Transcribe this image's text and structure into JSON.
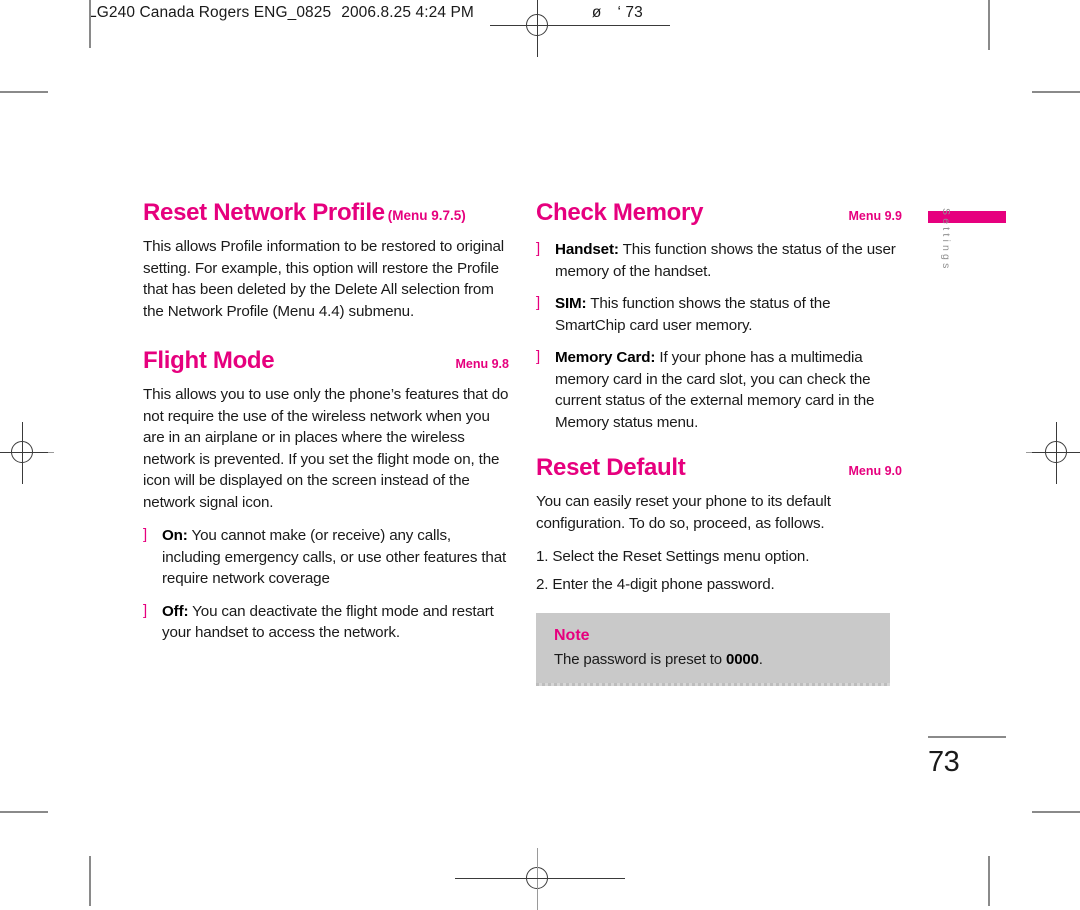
{
  "print_header": {
    "job": "LG240 Canada Rogers ENG_0825",
    "timestamp": "2006.8.25 4:24 PM",
    "ghost_mark": "ø",
    "page_mark": "‘ 73"
  },
  "side_tab": {
    "label": "Settings"
  },
  "page_footer": {
    "page_number": "73"
  },
  "left_column": {
    "sections": [
      {
        "title": "Reset Network Profile",
        "menu_inline": "(Menu 9.7.5)",
        "body": "This allows Profile information to be restored to original setting. For example, this option will restore the Profile that has been deleted by the Delete All selection from the Network Profile (Menu 4.4) submenu."
      },
      {
        "title": "Flight Mode",
        "menu_right": "Menu 9.8",
        "body": "This allows you to use only the phone’s features that do not require the use of the wireless network when you are in an airplane or in places where the wireless network is prevented. If you set the flight mode on, the icon will be displayed on the screen instead of the network signal icon.",
        "bullets": [
          {
            "marker": "]",
            "term": "On:",
            "text": " You cannot make (or receive) any calls, including emergency calls, or use other features that require network coverage"
          },
          {
            "marker": "]",
            "term": "Off:",
            "text": " You can deactivate the flight mode and restart your handset to access the network."
          }
        ]
      }
    ]
  },
  "right_column": {
    "sections": [
      {
        "title": "Check Memory",
        "menu_right": "Menu 9.9",
        "bullets": [
          {
            "marker": "]",
            "term": "Handset:",
            "text": " This function shows the status of the user memory of the handset."
          },
          {
            "marker": "]",
            "term": "SIM:",
            "text": " This function shows the status of the SmartChip card user memory."
          },
          {
            "marker": "]",
            "term": "Memory Card:",
            "text": " If your phone has a multimedia memory card in the card slot, you can check the current status of the external memory card in the Memory status menu."
          }
        ]
      },
      {
        "title": "Reset Default",
        "menu_right": "Menu 9.0",
        "body": "You can easily reset your phone to its default configuration. To do so, proceed, as follows.",
        "steps": [
          "1. Select the Reset Settings menu option.",
          "2. Enter the 4-digit phone password."
        ],
        "note": {
          "title": "Note",
          "text_before": "The password is preset to ",
          "value": "0000",
          "text_after": "."
        }
      }
    ]
  },
  "colors": {
    "accent_magenta": "#E6007E",
    "note_background": "#C9C9C9",
    "body_text": "#1A1A1A",
    "tab_label_gray": "#909090"
  }
}
